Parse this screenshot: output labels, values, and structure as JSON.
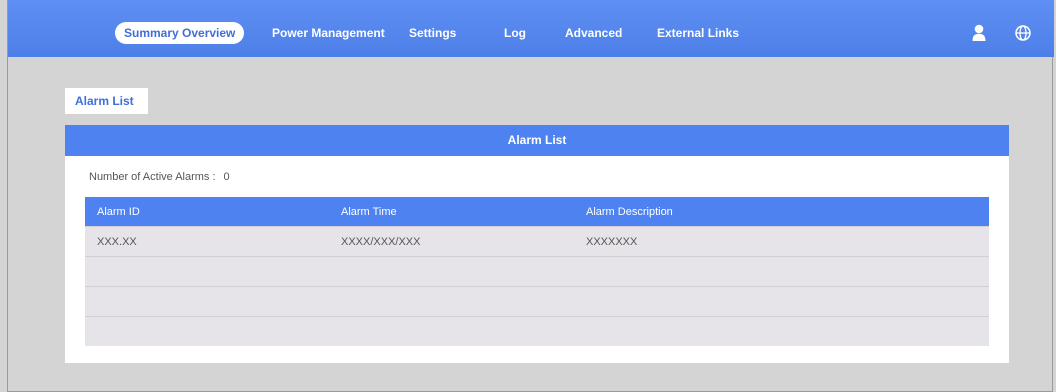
{
  "nav": {
    "items": [
      {
        "label": "Summary Overview",
        "active": true
      },
      {
        "label": "Power Management",
        "active": false
      },
      {
        "label": "Settings",
        "active": false
      },
      {
        "label": "Log",
        "active": false
      },
      {
        "label": "Advanced",
        "active": false
      },
      {
        "label": "External Links",
        "active": false
      }
    ],
    "icons": [
      "user-icon",
      "globe-icon"
    ]
  },
  "page": {
    "tab_label": "Alarm List",
    "card_title": "Alarm List",
    "active_alarms_label": "Number of Active Alarms :",
    "active_alarms_count": "0"
  },
  "table": {
    "headers": [
      "Alarm ID",
      "Alarm Time",
      "Alarm Description"
    ],
    "rows": [
      [
        "XXX.XX",
        "XXXX/XXX/XXX",
        "XXXXXXX"
      ],
      [
        "",
        "",
        ""
      ],
      [
        "",
        "",
        ""
      ],
      [
        "",
        "",
        ""
      ]
    ]
  },
  "colors": {
    "nav_blue": "#5f8ff3",
    "header_blue": "#4d82f0",
    "page_bg": "#d4d4d4",
    "row_bg": "#e6e4e8"
  }
}
